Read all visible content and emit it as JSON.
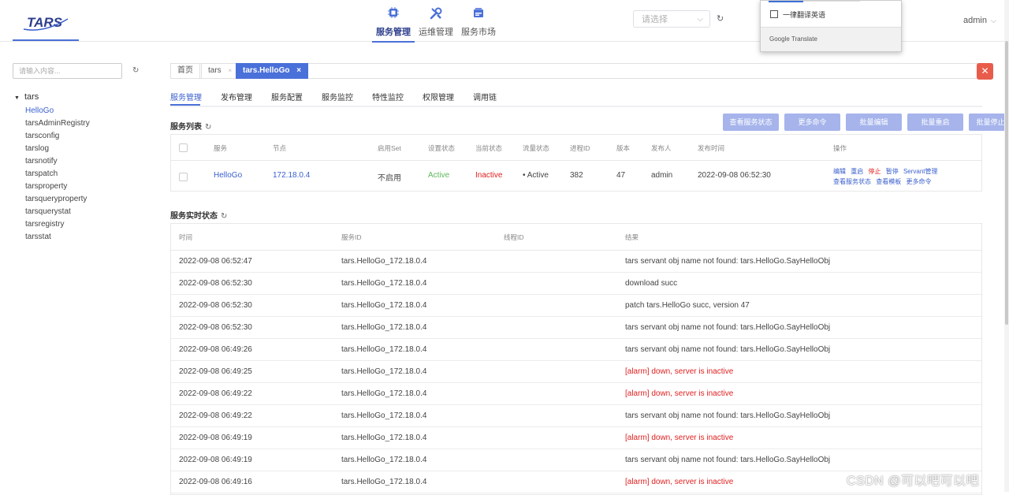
{
  "header": {
    "logo_text": "TARS",
    "nav": [
      {
        "label": "服务管理",
        "icon": "server-icon",
        "active": true
      },
      {
        "label": "运维管理",
        "icon": "wrench-icon",
        "active": false
      },
      {
        "label": "服务市场",
        "icon": "market-icon",
        "active": false
      }
    ],
    "select_placeholder": "请选择",
    "user": "admin"
  },
  "translate_popup": {
    "checkbox_label": "一律翻译英语",
    "footer": "Google Translate"
  },
  "sidebar": {
    "search_placeholder": "请输入内容...",
    "root": "tars",
    "items": [
      "HelloGo",
      "tarsAdminRegistry",
      "tarsconfig",
      "tarslog",
      "tarsnotify",
      "tarspatch",
      "tarsproperty",
      "tarsqueryproperty",
      "tarsquerystat",
      "tarsregistry",
      "tarsstat"
    ],
    "selected": "HelloGo"
  },
  "page_tabs": [
    "首页",
    "tars",
    "tars.HelloGo"
  ],
  "sub_tabs": [
    "服务管理",
    "发布管理",
    "服务配置",
    "服务监控",
    "特性监控",
    "权限管理",
    "调用链"
  ],
  "service_list": {
    "title": "服务列表",
    "buttons": [
      "查看服务状态",
      "更多命令",
      "批量编辑",
      "批量重启",
      "批量停止"
    ],
    "columns": [
      "服务",
      "节点",
      "启用Set",
      "设置状态",
      "当前状态",
      "流量状态",
      "进程ID",
      "版本",
      "发布人",
      "发布时间",
      "操作"
    ],
    "row": {
      "service": "HelloGo",
      "node": "172.18.0.4",
      "set": "不启用",
      "setting_state": "Active",
      "current_state": "Inactive",
      "flow_state": "• Active",
      "pid": "382",
      "version": "47",
      "publisher": "admin",
      "publish_time": "2022-09-08 06:52:30",
      "ops_line1": [
        "编辑",
        "重启",
        "停止",
        "暂停",
        "Servant管理"
      ],
      "ops_line2": [
        "查看服务状态",
        "查看模板",
        "更多命令"
      ]
    }
  },
  "realtime": {
    "title": "服务实时状态",
    "columns": [
      "时间",
      "服务ID",
      "线程ID",
      "结果"
    ],
    "rows": [
      {
        "time": "2022-09-08 06:52:47",
        "id": "tars.HelloGo_172.18.0.4",
        "tid": "",
        "result": "tars servant obj name not found: tars.HelloGo.SayHelloObj",
        "alarm": false
      },
      {
        "time": "2022-09-08 06:52:30",
        "id": "tars.HelloGo_172.18.0.4",
        "tid": "",
        "result": "download succ",
        "alarm": false
      },
      {
        "time": "2022-09-08 06:52:30",
        "id": "tars.HelloGo_172.18.0.4",
        "tid": "",
        "result": "patch tars.HelloGo succ, version 47",
        "alarm": false
      },
      {
        "time": "2022-09-08 06:52:30",
        "id": "tars.HelloGo_172.18.0.4",
        "tid": "",
        "result": "tars servant obj name not found: tars.HelloGo.SayHelloObj",
        "alarm": false
      },
      {
        "time": "2022-09-08 06:49:26",
        "id": "tars.HelloGo_172.18.0.4",
        "tid": "",
        "result": "tars servant obj name not found: tars.HelloGo.SayHelloObj",
        "alarm": false
      },
      {
        "time": "2022-09-08 06:49:25",
        "id": "tars.HelloGo_172.18.0.4",
        "tid": "",
        "result": "[alarm] down, server is inactive",
        "alarm": true
      },
      {
        "time": "2022-09-08 06:49:22",
        "id": "tars.HelloGo_172.18.0.4",
        "tid": "",
        "result": "[alarm] down, server is inactive",
        "alarm": true
      },
      {
        "time": "2022-09-08 06:49:22",
        "id": "tars.HelloGo_172.18.0.4",
        "tid": "",
        "result": "tars servant obj name not found: tars.HelloGo.SayHelloObj",
        "alarm": false
      },
      {
        "time": "2022-09-08 06:49:19",
        "id": "tars.HelloGo_172.18.0.4",
        "tid": "",
        "result": "[alarm] down, server is inactive",
        "alarm": true
      },
      {
        "time": "2022-09-08 06:49:19",
        "id": "tars.HelloGo_172.18.0.4",
        "tid": "",
        "result": "tars servant obj name not found: tars.HelloGo.SayHelloObj",
        "alarm": false
      },
      {
        "time": "2022-09-08 06:49:16",
        "id": "tars.HelloGo_172.18.0.4",
        "tid": "",
        "result": "[alarm] down, server is inactive",
        "alarm": true
      }
    ]
  },
  "watermark": "CSDN @可以吧可以吧",
  "colors": {
    "accent": "#4a70d9",
    "button": "#a6b4eb",
    "danger": "#e95c4b",
    "active": "#5cb85c",
    "alarm": "#e02020"
  }
}
